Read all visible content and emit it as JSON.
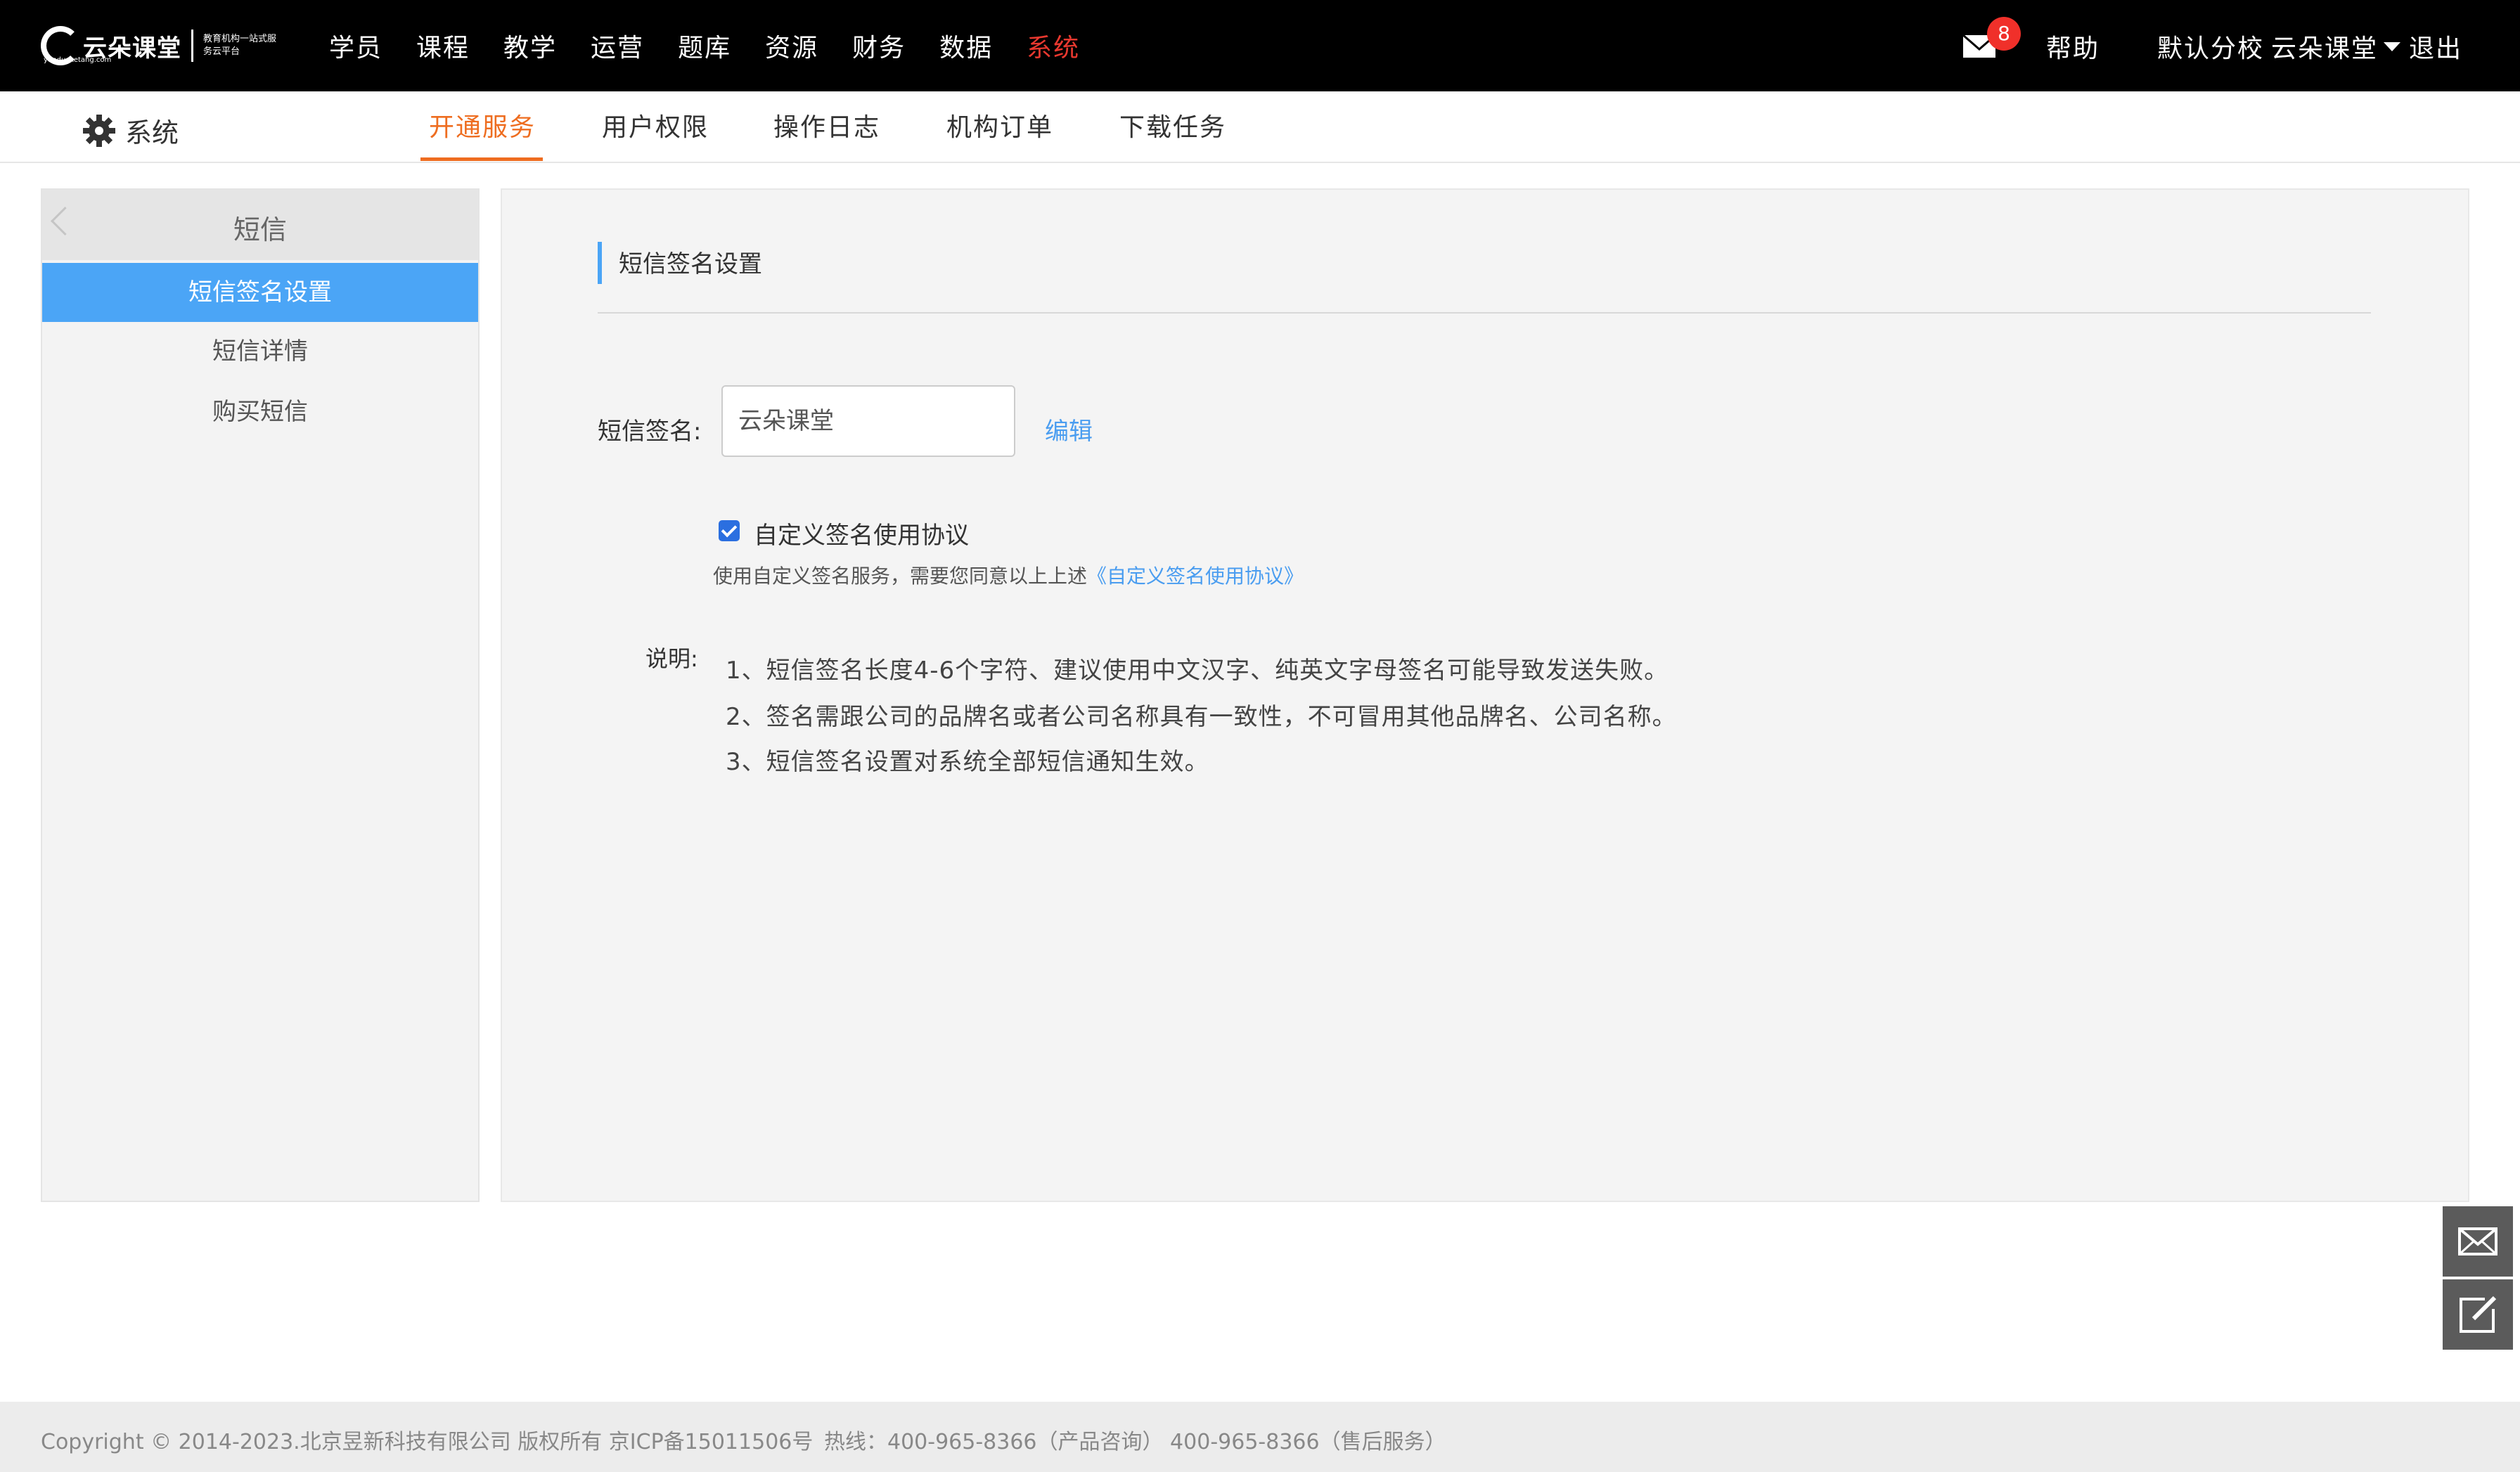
{
  "brand": {
    "name": "云朵课堂",
    "slogan": "教育机构一站式服务云平台",
    "url": "yunduoketang.com"
  },
  "main_nav": [
    "学员",
    "课程",
    "教学",
    "运营",
    "题库",
    "资源",
    "财务",
    "数据",
    "系统"
  ],
  "main_nav_active": "系统",
  "top_right": {
    "mail_badge": "8",
    "help": "帮助",
    "campus": "默认分校",
    "user": "云朵课堂",
    "logout": "退出"
  },
  "sub_nav": {
    "title": "系统",
    "tabs": [
      "开通服务",
      "用户权限",
      "操作日志",
      "机构订单",
      "下载任务"
    ],
    "active_tab": "开通服务"
  },
  "sidebar": {
    "title": "短信",
    "items": [
      "短信签名设置",
      "短信详情",
      "购买短信"
    ],
    "active_item": "短信签名设置"
  },
  "content": {
    "section_title": "短信签名设置",
    "signature_label": "短信签名:",
    "signature_value": "云朵课堂",
    "edit_link": "编辑",
    "agreement_checked": true,
    "agreement_label": "自定义签名使用协议",
    "agreement_note": "使用自定义签名服务，需要您同意以上上述",
    "agreement_link": "《自定义签名使用协议》",
    "notes_label": "说明:",
    "notes": [
      "1、短信签名长度4-6个字符、建议使用中文汉字、纯英文字母签名可能导致发送失败。",
      "2、签名需跟公司的品牌名或者公司名称具有一致性，不可冒用其他品牌名、公司名称。",
      "3、短信签名设置对系统全部短信通知生效。"
    ]
  },
  "footer": {
    "copyright": "Copyright © 2014-2023.北京昱新科技有限公司 版权所有 京ICP备15011506号",
    "hotline": "热线：400-965-8366（产品咨询） 400-965-8366（售后服务）"
  },
  "colors": {
    "topbar_bg": "#000000",
    "accent_active_nav": "#e8382f",
    "accent_tab": "#ee6d20",
    "sidebar_active": "#4ba5f6",
    "link": "#4a9df0"
  }
}
